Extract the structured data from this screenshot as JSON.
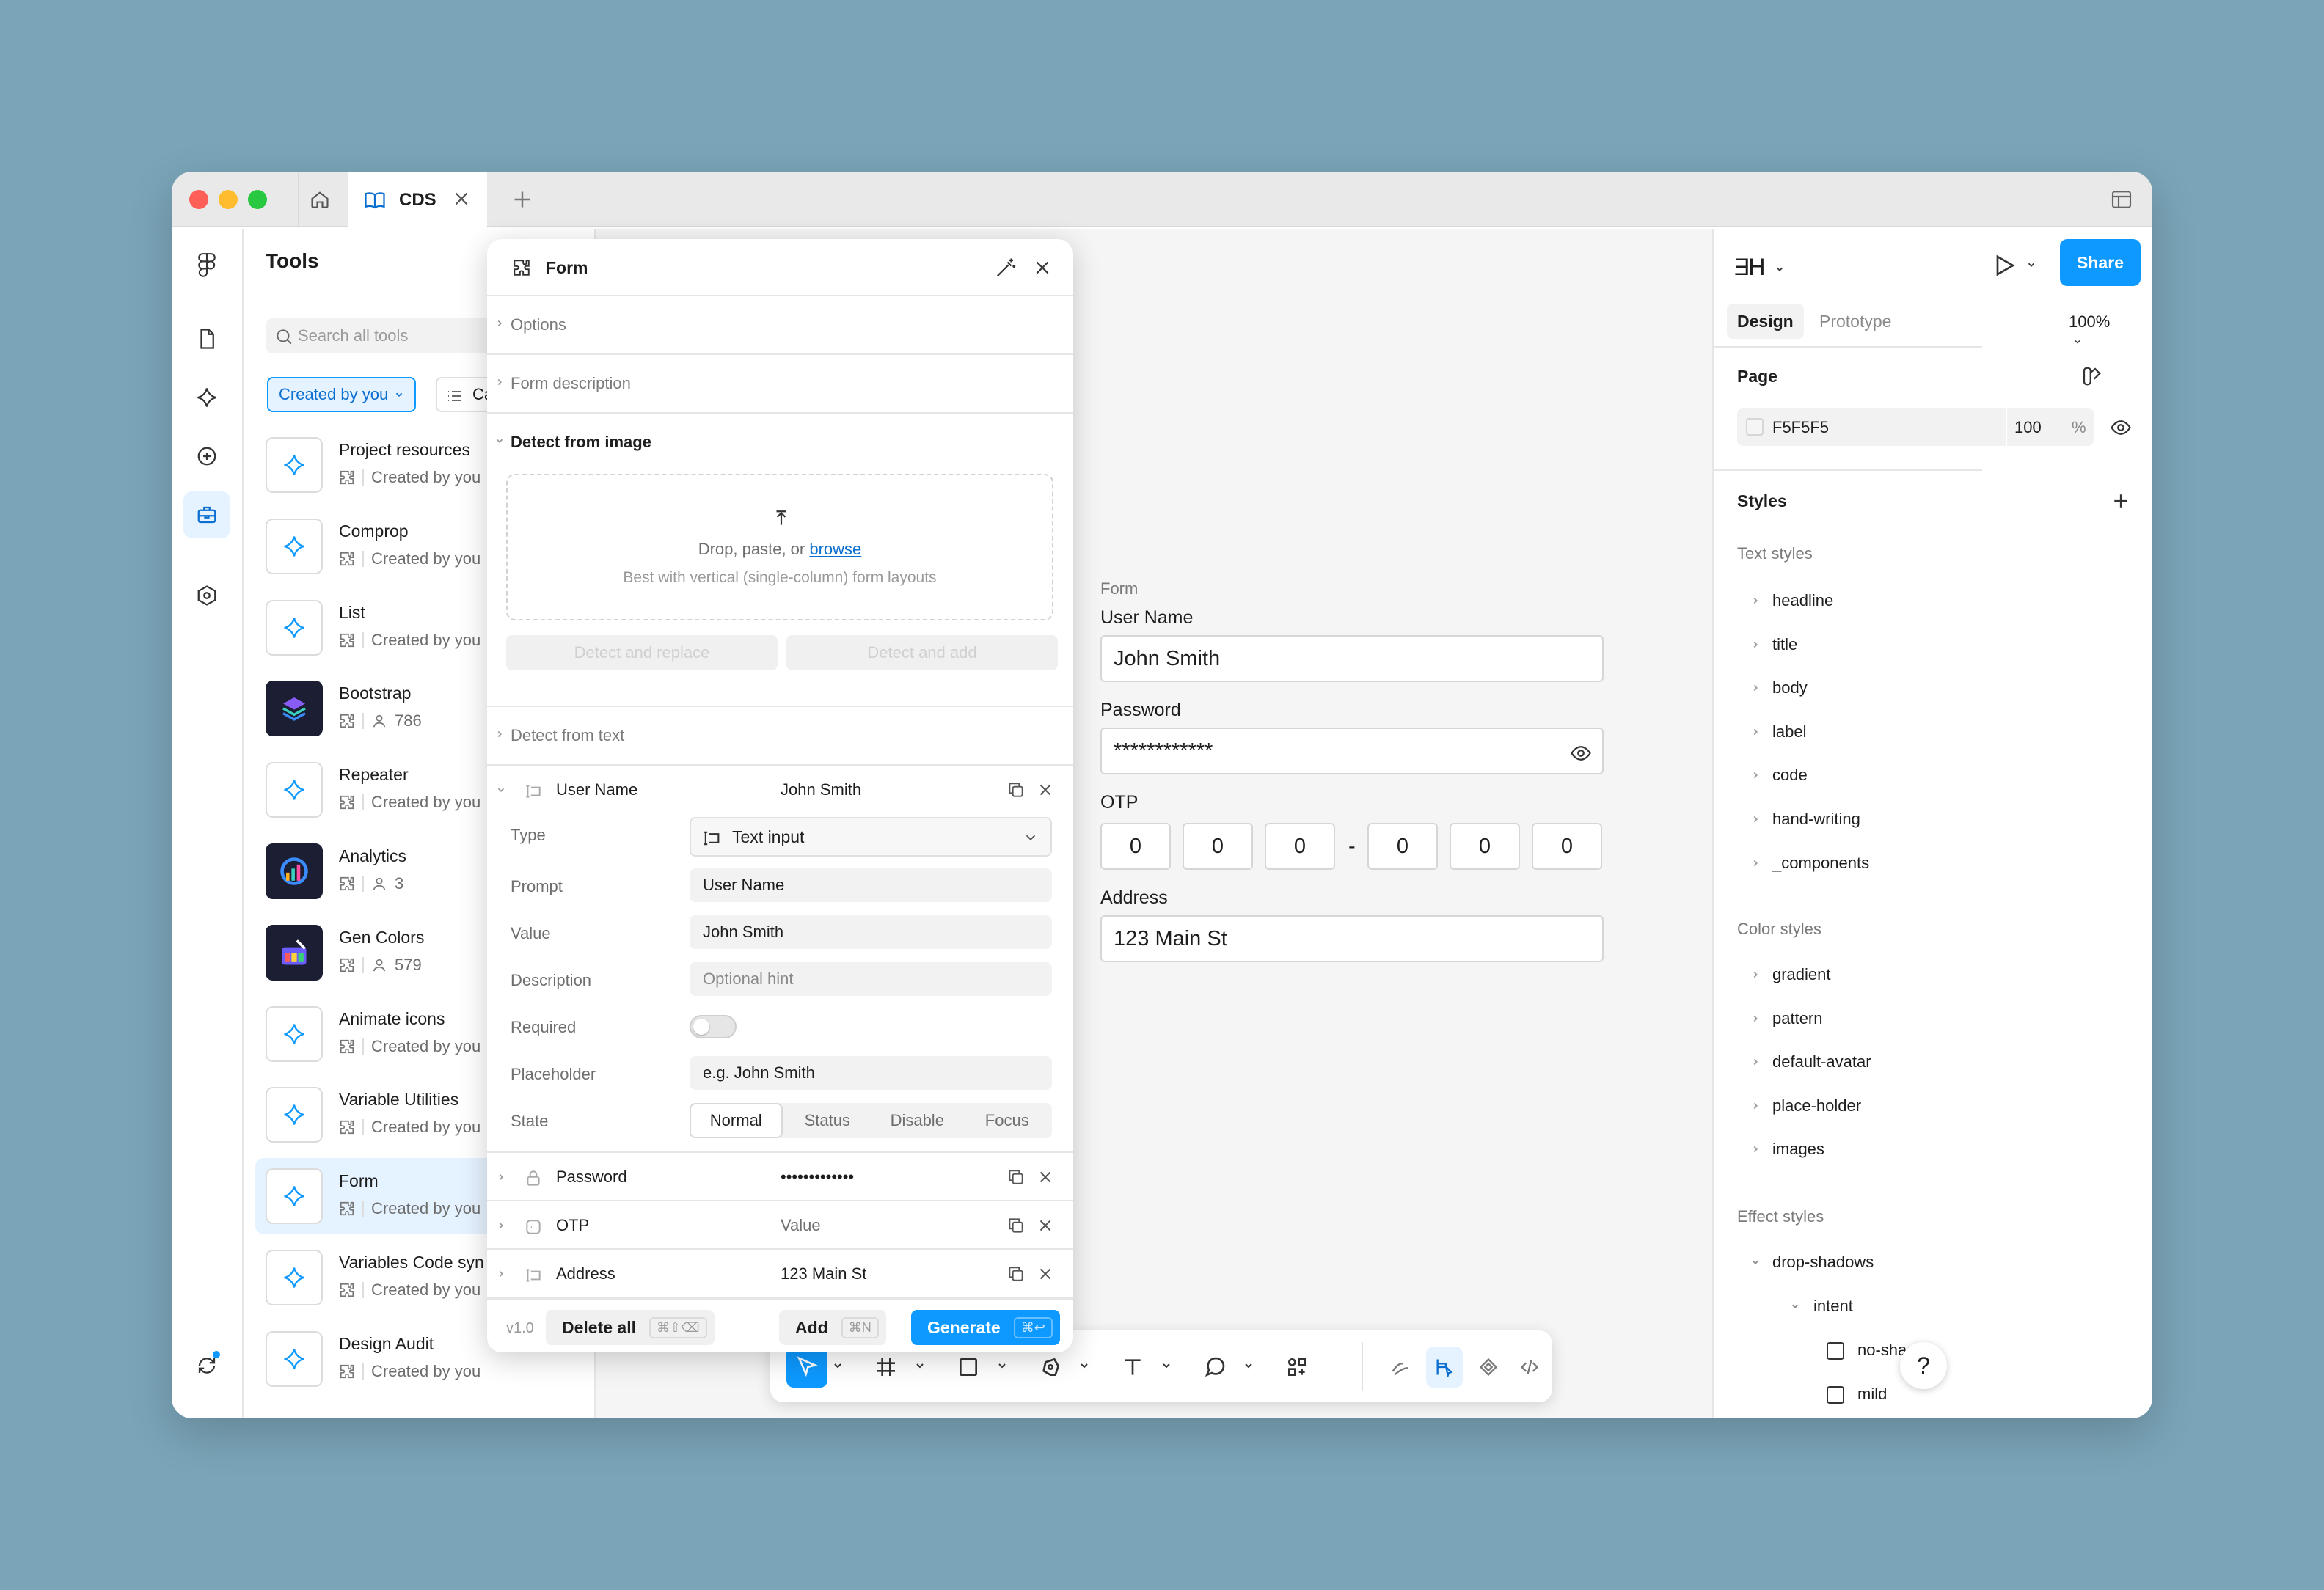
{
  "titlebar": {
    "tab_label": "CDS"
  },
  "tools_panel": {
    "title": "Tools",
    "search_placeholder": "Search all tools",
    "filter_created": "Created by you",
    "filter_category": "Ca",
    "items": [
      {
        "name": "Project resources",
        "meta": "Created by you"
      },
      {
        "name": "Comprop",
        "meta": "Created by you"
      },
      {
        "name": "List",
        "meta": "Created by you"
      },
      {
        "name": "Bootstrap",
        "meta": "786"
      },
      {
        "name": "Repeater",
        "meta": "Created by you"
      },
      {
        "name": "Analytics",
        "meta": "3"
      },
      {
        "name": "Gen Colors",
        "meta": "579"
      },
      {
        "name": "Animate icons",
        "meta": "Created by you"
      },
      {
        "name": "Variable Utilities",
        "meta": "Created by you"
      },
      {
        "name": "Form",
        "meta": "Created by you"
      },
      {
        "name": "Variables Code syn",
        "meta": "Created by you"
      },
      {
        "name": "Design Audit",
        "meta": "Created by you"
      }
    ]
  },
  "dialog": {
    "title": "Form",
    "sections": {
      "options": "Options",
      "form_description": "Form description",
      "detect_image": "Detect from image",
      "detect_text": "Detect from text"
    },
    "dropzone": {
      "line1_prefix": "Drop, paste, or ",
      "browse": "browse",
      "line2": "Best with vertical (single-column) form layouts"
    },
    "detect_replace": "Detect and replace",
    "detect_add": "Detect and add",
    "fields": [
      {
        "name": "User Name",
        "value": "John Smith"
      },
      {
        "name": "Password",
        "value": "•••••••••••••"
      },
      {
        "name": "OTP",
        "value": "Value"
      },
      {
        "name": "Address",
        "value": "123 Main St"
      }
    ],
    "props": {
      "type_label": "Type",
      "type_value": "Text input",
      "prompt_label": "Prompt",
      "prompt_value": "User Name",
      "value_label": "Value",
      "value_value": "John Smith",
      "description_label": "Description",
      "description_placeholder": "Optional hint",
      "required_label": "Required",
      "placeholder_label": "Placeholder",
      "placeholder_value": "e.g. John Smith",
      "state_label": "State",
      "states": [
        "Normal",
        "Status",
        "Disable",
        "Focus"
      ]
    },
    "footer": {
      "version": "v1.0",
      "delete_all": "Delete all",
      "delete_kbd": "⌘⇧⌫",
      "add": "Add",
      "add_kbd": "⌘N",
      "generate": "Generate",
      "generate_kbd": "⌘↩"
    }
  },
  "canvas": {
    "frame_label": "Form",
    "username_label": "User Name",
    "username_value": "John Smith",
    "password_label": "Password",
    "password_value": "************",
    "otp_label": "OTP",
    "otp_digits": [
      "0",
      "0",
      "0",
      "0",
      "0",
      "0"
    ],
    "otp_dash": "-",
    "address_label": "Address",
    "address_value": "123 Main St"
  },
  "right_panel": {
    "avatar": "ƎH",
    "share": "Share",
    "tab_design": "Design",
    "tab_prototype": "Prototype",
    "zoom": "100%",
    "page_heading": "Page",
    "page_color": "F5F5F5",
    "page_opacity": "100",
    "page_pct": "%",
    "styles_heading": "Styles",
    "text_styles_heading": "Text styles",
    "text_styles": [
      "headline",
      "title",
      "body",
      "label",
      "code",
      "hand-writing",
      "_components"
    ],
    "color_styles_heading": "Color styles",
    "color_styles": [
      "gradient",
      "pattern",
      "default-avatar",
      "place-holder",
      "images"
    ],
    "effect_styles_heading": "Effect styles",
    "effect_group": "drop-shadows",
    "effect_subgroup": "intent",
    "effect_items": [
      "no-shadow",
      "mild"
    ]
  },
  "help": "?",
  "colors": {
    "accent": "#0d99ff",
    "background": "#7aa4b8",
    "canvas": "#f5f5f5"
  }
}
